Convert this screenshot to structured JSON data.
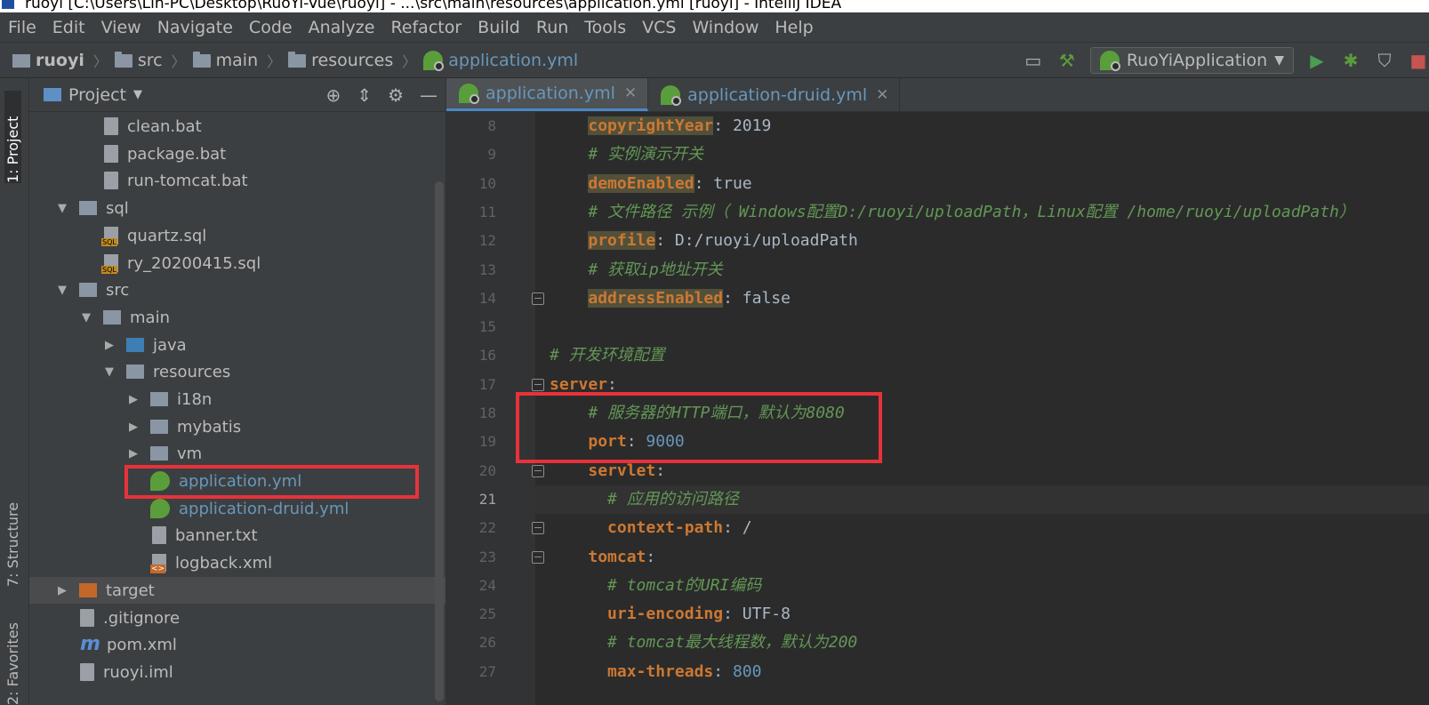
{
  "window": {
    "title": "ruoyi [C:\\Users\\Lin-PC\\Desktop\\RuoYi-Vue\\ruoyi] - ...\\src\\main\\resources\\application.yml [ruoyi] - IntelliJ IDEA"
  },
  "menu": [
    "File",
    "Edit",
    "View",
    "Navigate",
    "Code",
    "Analyze",
    "Refactor",
    "Build",
    "Run",
    "Tools",
    "VCS",
    "Window",
    "Help"
  ],
  "breadcrumb": {
    "project": "ruoyi",
    "items": [
      "src",
      "main",
      "resources"
    ],
    "file": "application.yml"
  },
  "run_config": {
    "label": "RuoYiApplication"
  },
  "left_strip": {
    "project_tab": "1: Project",
    "structure_tab": "7: Structure",
    "favorites_tab": "2: Favorites"
  },
  "project_panel": {
    "title": "Project",
    "tree": [
      {
        "name": "clean.bat",
        "icon": "file-icon"
      },
      {
        "name": "package.bat",
        "icon": "file-icon"
      },
      {
        "name": "run-tomcat.bat",
        "icon": "file-icon"
      },
      {
        "name": "sql",
        "icon": "folder-icon"
      },
      {
        "name": "quartz.sql",
        "icon": "sql-file-icon"
      },
      {
        "name": "ry_20200415.sql",
        "icon": "sql-file-icon"
      },
      {
        "name": "src",
        "icon": "folder-icon"
      },
      {
        "name": "main",
        "icon": "folder-icon"
      },
      {
        "name": "java",
        "icon": "source-folder-icon"
      },
      {
        "name": "resources",
        "icon": "resources-folder-icon"
      },
      {
        "name": "i18n",
        "icon": "package-icon"
      },
      {
        "name": "mybatis",
        "icon": "package-icon"
      },
      {
        "name": "vm",
        "icon": "package-icon"
      },
      {
        "name": "application.yml",
        "icon": "spring-config-icon"
      },
      {
        "name": "application-druid.yml",
        "icon": "spring-config-icon"
      },
      {
        "name": "banner.txt",
        "icon": "text-file-icon"
      },
      {
        "name": "logback.xml",
        "icon": "xml-file-icon"
      },
      {
        "name": "target",
        "icon": "excluded-folder-icon"
      },
      {
        "name": ".gitignore",
        "icon": "file-icon"
      },
      {
        "name": "pom.xml",
        "icon": "maven-icon"
      },
      {
        "name": "ruoyi.iml",
        "icon": "module-file-icon"
      }
    ]
  },
  "editor": {
    "tabs": [
      {
        "label": "application.yml",
        "active": true
      },
      {
        "label": "application-druid.yml",
        "active": false
      }
    ],
    "current_line": 21,
    "lines": [
      {
        "n": "8",
        "indent": "    ",
        "key": "copyrightYear",
        "sep": ": ",
        "val": "2019",
        "val_type": "text",
        "comment": "",
        "mark": true
      },
      {
        "n": "9",
        "indent": "    ",
        "key": "",
        "sep": "",
        "val": "",
        "val_type": "",
        "comment": "# 实例演示开关",
        "mark": false
      },
      {
        "n": "10",
        "indent": "    ",
        "key": "demoEnabled",
        "sep": ": ",
        "val": "true",
        "val_type": "text",
        "comment": "",
        "mark": true
      },
      {
        "n": "11",
        "indent": "    ",
        "key": "",
        "sep": "",
        "val": "",
        "val_type": "",
        "comment": "# 文件路径 示例（ Windows配置D:/ruoyi/uploadPath，Linux配置 /home/ruoyi/uploadPath）",
        "mark": false
      },
      {
        "n": "12",
        "indent": "    ",
        "key": "profile",
        "sep": ": ",
        "val": "D:/ruoyi/uploadPath",
        "val_type": "text",
        "comment": "",
        "mark": true
      },
      {
        "n": "13",
        "indent": "    ",
        "key": "",
        "sep": "",
        "val": "",
        "val_type": "",
        "comment": "# 获取ip地址开关",
        "mark": false
      },
      {
        "n": "14",
        "indent": "    ",
        "key": "addressEnabled",
        "sep": ": ",
        "val": "false",
        "val_type": "text",
        "comment": "",
        "mark": true
      },
      {
        "n": "15",
        "indent": "",
        "key": "",
        "sep": "",
        "val": "",
        "val_type": "",
        "comment": "",
        "mark": false
      },
      {
        "n": "16",
        "indent": "",
        "key": "",
        "sep": "",
        "val": "",
        "val_type": "",
        "comment": "# 开发环境配置",
        "mark": false
      },
      {
        "n": "17",
        "indent": "",
        "key": "server",
        "sep": ":",
        "val": "",
        "val_type": "",
        "comment": "",
        "mark": false
      },
      {
        "n": "18",
        "indent": "    ",
        "key": "",
        "sep": "",
        "val": "",
        "val_type": "",
        "comment": "# 服务器的HTTP端口，默认为8080",
        "mark": false
      },
      {
        "n": "19",
        "indent": "    ",
        "key": "port",
        "sep": ": ",
        "val": "9000",
        "val_type": "number",
        "comment": "",
        "mark": false
      },
      {
        "n": "20",
        "indent": "    ",
        "key": "servlet",
        "sep": ":",
        "val": "",
        "val_type": "",
        "comment": "",
        "mark": false
      },
      {
        "n": "21",
        "indent": "      ",
        "key": "",
        "sep": "",
        "val": "",
        "val_type": "",
        "comment": "# 应用的访问路径",
        "mark": false
      },
      {
        "n": "22",
        "indent": "      ",
        "key": "context-path",
        "sep": ": ",
        "val": "/",
        "val_type": "text",
        "comment": "",
        "mark": false
      },
      {
        "n": "23",
        "indent": "    ",
        "key": "tomcat",
        "sep": ":",
        "val": "",
        "val_type": "",
        "comment": "",
        "mark": false
      },
      {
        "n": "24",
        "indent": "      ",
        "key": "",
        "sep": "",
        "val": "",
        "val_type": "",
        "comment": "# tomcat的URI编码",
        "mark": false
      },
      {
        "n": "25",
        "indent": "      ",
        "key": "uri-encoding",
        "sep": ": ",
        "val": "UTF-8",
        "val_type": "text",
        "comment": "",
        "mark": false
      },
      {
        "n": "26",
        "indent": "      ",
        "key": "",
        "sep": "",
        "val": "",
        "val_type": "",
        "comment": "# tomcat最大线程数，默认为200",
        "mark": false
      },
      {
        "n": "27",
        "indent": "      ",
        "key": "max-threads",
        "sep": ": ",
        "val": "800",
        "val_type": "number",
        "comment": "",
        "mark": false
      }
    ]
  },
  "colors": {
    "highlight_box": "#e8323a",
    "keyword": "#cc7832",
    "comment": "#629755",
    "number": "#6897bb"
  }
}
